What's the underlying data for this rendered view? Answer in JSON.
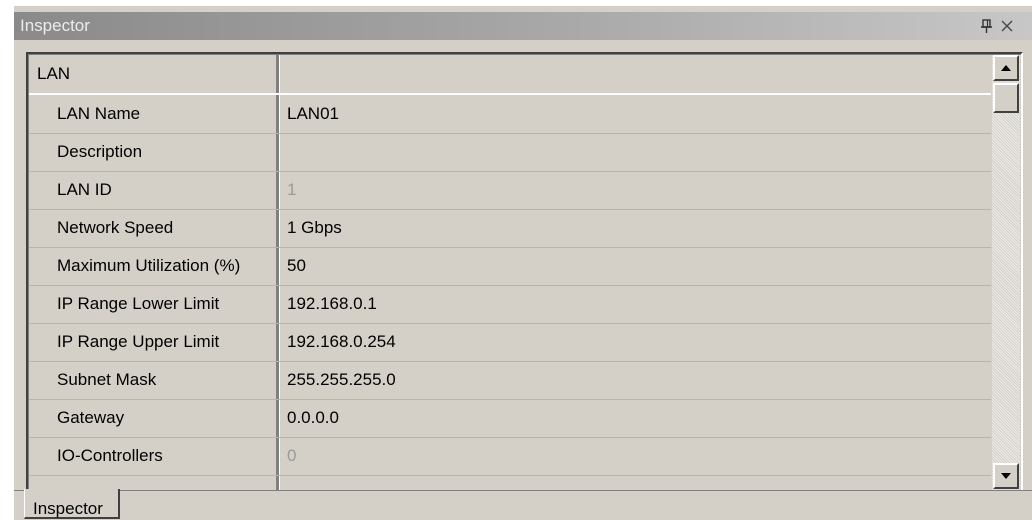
{
  "window": {
    "title": "Inspector",
    "pin_icon": "pin-icon",
    "close_icon": "close-icon"
  },
  "grid": {
    "section": "LAN",
    "rows": [
      {
        "name": "LAN Name",
        "value": "LAN01",
        "readonly": false
      },
      {
        "name": "Description",
        "value": "",
        "readonly": false
      },
      {
        "name": "LAN ID",
        "value": "1",
        "readonly": true
      },
      {
        "name": "Network Speed",
        "value": "1 Gbps",
        "readonly": false
      },
      {
        "name": "Maximum Utilization (%)",
        "value": "50",
        "readonly": false
      },
      {
        "name": "IP Range Lower Limit",
        "value": "192.168.0.1",
        "readonly": false
      },
      {
        "name": "IP Range Upper Limit",
        "value": "192.168.0.254",
        "readonly": false
      },
      {
        "name": "Subnet Mask",
        "value": "255.255.255.0",
        "readonly": false
      },
      {
        "name": "Gateway",
        "value": "0.0.0.0",
        "readonly": false
      },
      {
        "name": "IO-Controllers",
        "value": "0",
        "readonly": true
      }
    ]
  },
  "tabs": [
    {
      "label": "Inspector",
      "active": true
    }
  ],
  "colors": {
    "panel": "#d4d0c8",
    "readonly_text": "#9a9a9a",
    "title_text": "#ececec"
  }
}
